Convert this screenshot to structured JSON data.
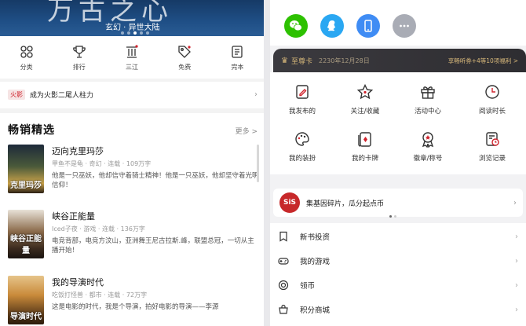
{
  "left": {
    "banner": {
      "title": "万古之心",
      "subtitle": "玄幻 · 异世大陆"
    },
    "categories": [
      {
        "label": "分类",
        "icon": "grid-icon"
      },
      {
        "label": "排行",
        "icon": "trophy-icon"
      },
      {
        "label": "三江",
        "icon": "pillars-icon"
      },
      {
        "label": "免费",
        "icon": "tag-icon"
      },
      {
        "label": "完本",
        "icon": "book-icon"
      }
    ],
    "notice": {
      "tag": "火影",
      "text": "成为火影二尾人柱力"
    },
    "section": {
      "title": "畅销精选",
      "more": "更多 >"
    },
    "books": [
      {
        "title": "迈向克里玛莎",
        "meta": "甲鱼不是龟 · 奇幻 · 连载 · 109万字",
        "desc": "他是一只巫妖，他却信守着骑士精神！他是一只巫妖，他却坚守着光明信仰！",
        "cover_text": "克里玛莎"
      },
      {
        "title": "峡谷正能量",
        "meta": "Iced子夜 · 游戏 · 连载 · 136万字",
        "desc": "电竞背部，电竞方汶山，亚洲舞王尼古拉斯.峰，联盟总冠，一切从主播开始！",
        "cover_text": "峡谷正能量"
      },
      {
        "title": "我的导演时代",
        "meta": "吃饭打怪兽 · 都市 · 连载 · 72万字",
        "desc": "这是电影的时代，我是个导演，拍好电影的导演——李源",
        "cover_text": "导演时代"
      }
    ]
  },
  "right": {
    "share_icons": [
      "wechat-icon",
      "qq-icon",
      "phone-icon",
      "more-icon"
    ],
    "vip": {
      "title": "至尊卡",
      "date": "2230年12月28日",
      "right_text": "享畅听券+4等10项福利 >"
    },
    "grid": [
      {
        "label": "我发布的",
        "icon": "edit-icon"
      },
      {
        "label": "关注/收藏",
        "icon": "star-icon"
      },
      {
        "label": "活动中心",
        "icon": "gift-icon"
      },
      {
        "label": "阅读时长",
        "icon": "clock-icon"
      },
      {
        "label": "我的装扮",
        "icon": "palette-icon"
      },
      {
        "label": "我的卡牌",
        "icon": "cards-icon"
      },
      {
        "label": "徽章/称号",
        "icon": "badge-icon"
      },
      {
        "label": "浏览记录",
        "icon": "history-icon"
      }
    ],
    "promo": {
      "logo": "SiS",
      "text": "集基因碎片，瓜分起点币"
    },
    "list": [
      {
        "label": "新书投资",
        "icon": "bookmark-icon"
      },
      {
        "label": "我的游戏",
        "icon": "gamepad-icon"
      },
      {
        "label": "领币",
        "icon": "coin-icon"
      },
      {
        "label": "积分商城",
        "icon": "shop-icon"
      }
    ]
  },
  "colors": {
    "accent_red": "#d0232d",
    "vip_gold": "#d9b97b",
    "wechat": "#2dc100",
    "qq": "#2aa7f2",
    "phone": "#3f8cf4",
    "more": "#a9acb5"
  }
}
